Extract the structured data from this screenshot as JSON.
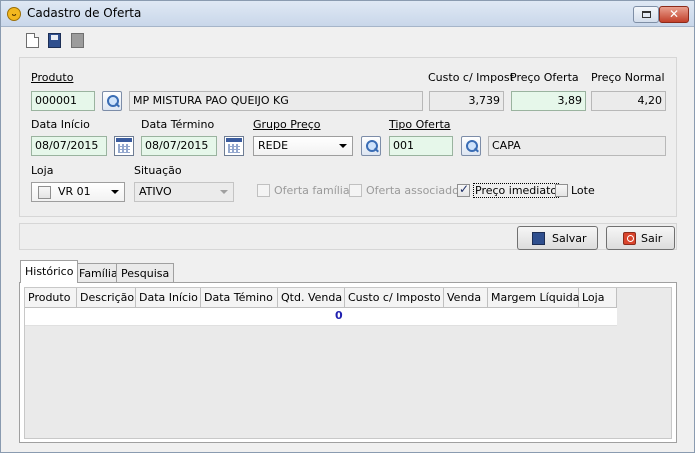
{
  "window": {
    "title": "Cadastro de Oferta"
  },
  "form": {
    "produto_label": "Produto",
    "produto_code": "000001",
    "produto_desc": "MP MISTURA PAO QUEIJO KG",
    "custo_label": "Custo c/ Impost",
    "custo_value": "3,739",
    "preco_oferta_label": "Preço Oferta",
    "preco_oferta_value": "3,89",
    "preco_normal_label": "Preço Normal",
    "preco_normal_value": "4,20",
    "data_inicio_label": "Data Início",
    "data_inicio_value": "08/07/2015",
    "data_termino_label": "Data Término",
    "data_termino_value": "08/07/2015",
    "grupo_preco_label": "Grupo Preço",
    "grupo_preco_value": "REDE",
    "tipo_oferta_label": "Tipo Oferta",
    "tipo_oferta_code": "001",
    "tipo_oferta_desc": "CAPA",
    "loja_label": "Loja",
    "loja_value": "VR 01",
    "situacao_label": "Situação",
    "situacao_value": "ATIVO",
    "oferta_familia_label": "Oferta família",
    "oferta_associado_label": "Oferta associado",
    "preco_imediato_label": "Preço imediato",
    "lote_label": "Lote"
  },
  "options": {
    "oferta_familia_checked": false,
    "oferta_associado_checked": false,
    "preco_imediato_checked": true,
    "lote_checked": false
  },
  "actions": {
    "salvar_label": "Salvar",
    "sair_label": "Sair"
  },
  "tabs": [
    "Histórico",
    "Família",
    "Pesquisa"
  ],
  "grid": {
    "columns": [
      "Produto",
      "Descrição",
      "Data Início",
      "Data Témino",
      "Qtd. Venda",
      "Custo c/ Imposto",
      "Venda",
      "Margem Líquida",
      "Loja"
    ],
    "total": "0"
  },
  "icons": [
    "new-document-icon",
    "save-icon",
    "delete-icon",
    "search-icon",
    "calendar-icon",
    "exit-icon"
  ]
}
